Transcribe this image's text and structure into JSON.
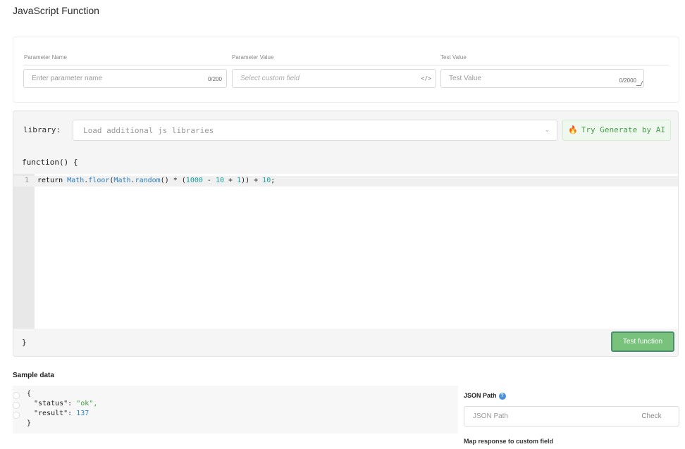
{
  "page": {
    "title": "JavaScript Function"
  },
  "parameters": {
    "headers": {
      "name": "Parameter Name",
      "value": "Parameter Value",
      "test": "Test Value"
    },
    "name_placeholder": "Enter parameter name",
    "name_counter": "0/200",
    "value_placeholder": "Select custom field",
    "value_icon": "</>",
    "test_placeholder": "Test Value",
    "test_counter": "0/2000"
  },
  "library": {
    "label": "library:",
    "placeholder": "Load additional js libraries",
    "ai_button": "Try Generate by AI",
    "ai_icon": "flame-icon"
  },
  "editor": {
    "header": "function() {",
    "footer": "}",
    "line_number": "1",
    "code_tokens": {
      "kw": "return ",
      "id1": "Math",
      "p1": ".",
      "id2": "floor",
      "p2": "(",
      "id3": "Math",
      "p3": ".",
      "id4": "random",
      "p4": "() * (",
      "n1": "1000",
      "p5": " - ",
      "n2": "10",
      "p6": " + ",
      "n3": "1",
      "p7": ")) + ",
      "n4": "10",
      "p8": ";"
    },
    "test_button": "Test function"
  },
  "sample": {
    "title": "Sample data",
    "lines": {
      "open": "{",
      "status_key": "\"status\": ",
      "status_val": "\"ok\"",
      "status_comma": ",",
      "result_key": "\"result\": ",
      "result_val": "137",
      "close": "}"
    }
  },
  "json_path": {
    "label": "JSON Path",
    "help_icon": "?",
    "placeholder": "JSON Path",
    "check_button": "Check",
    "next_label": "Map response to custom field"
  },
  "colors": {
    "accent_green": "#79c27c",
    "ai_green": "#4e9a4e",
    "link_blue": "#2d7fb8"
  }
}
